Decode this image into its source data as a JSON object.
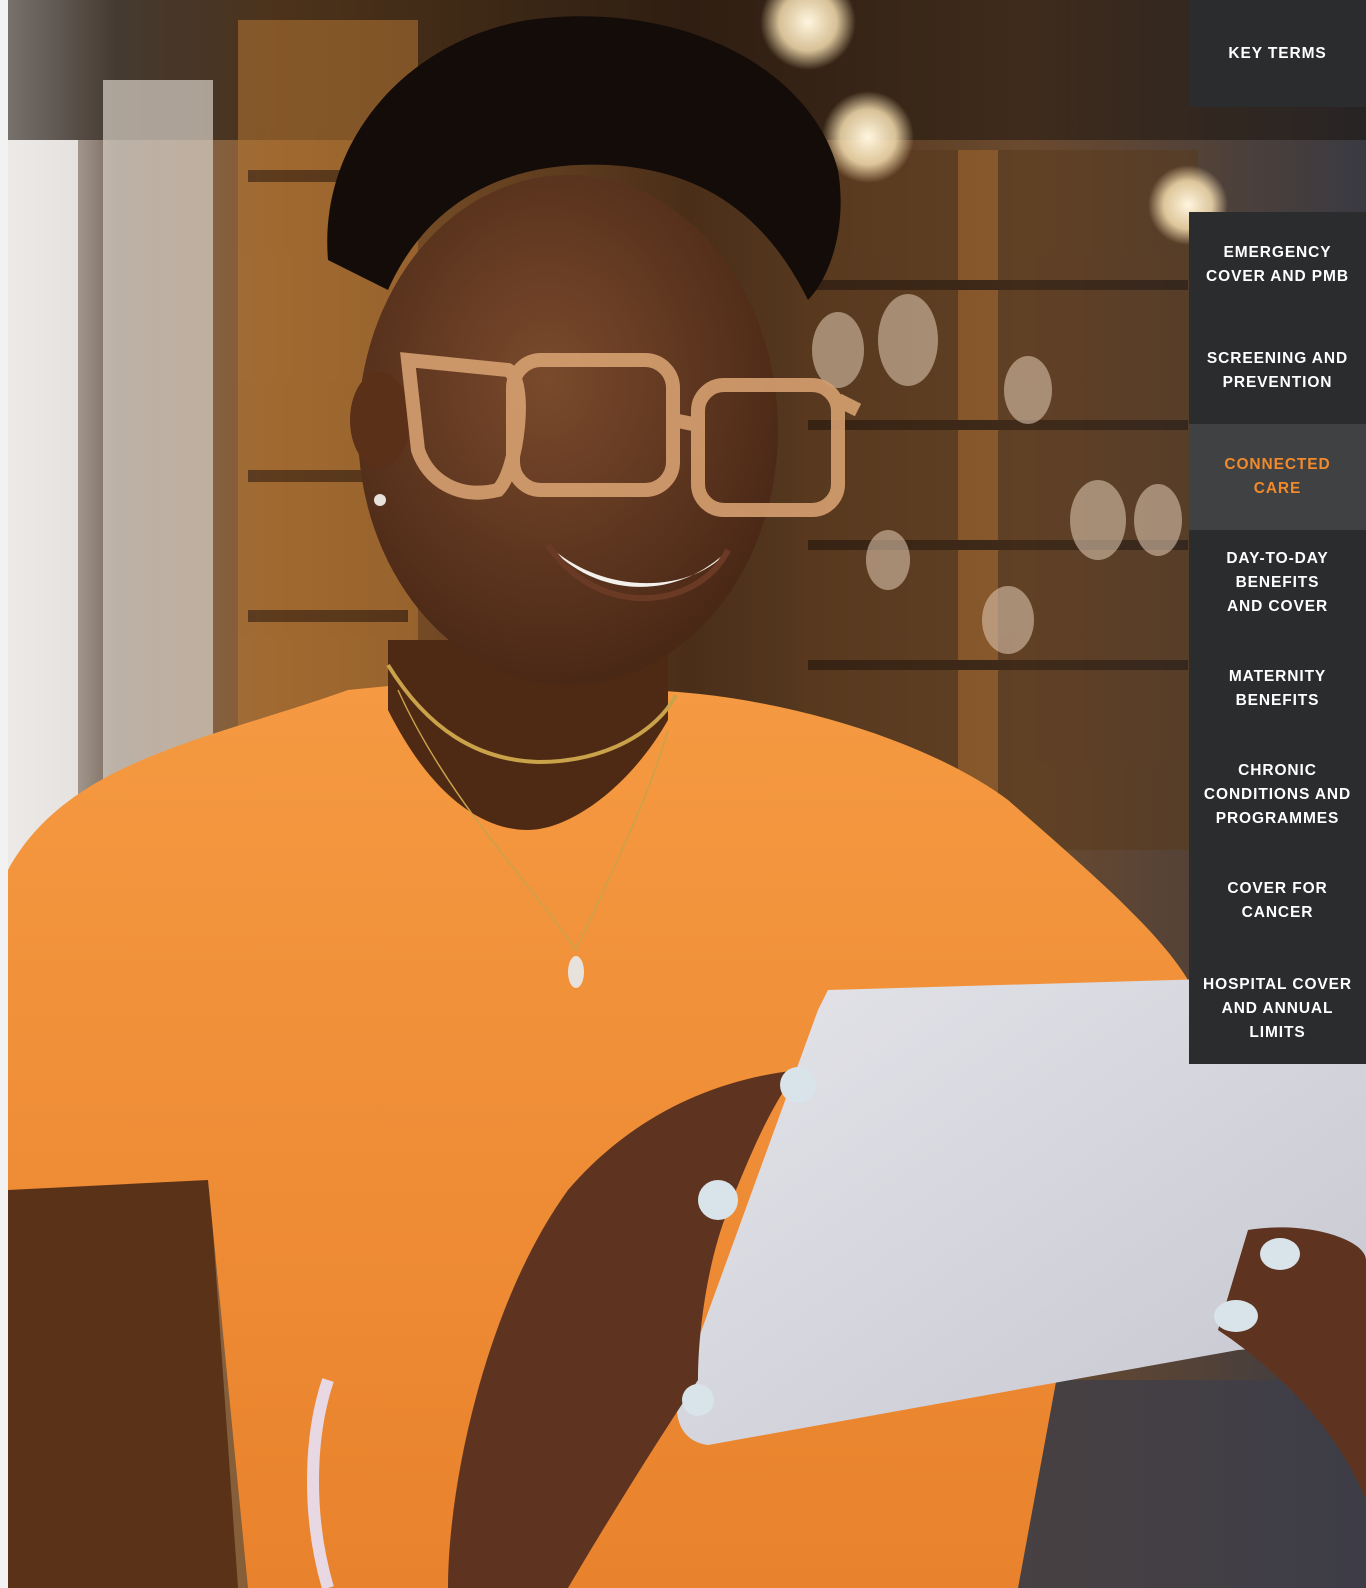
{
  "side_nav": {
    "key_terms_label": "KEY TERMS",
    "items": [
      {
        "label": "EMERGENCY\nCOVER AND PMB",
        "active": false
      },
      {
        "label": "SCREENING AND\nPREVENTION",
        "active": false
      },
      {
        "label": "CONNECTED\nCARE",
        "active": true
      },
      {
        "label": "DAY-TO-DAY\nBENEFITS\nAND COVER",
        "active": false
      },
      {
        "label": "MATERNITY\nBENEFITS",
        "active": false
      },
      {
        "label": "CHRONIC\nCONDITIONS AND\nPROGRAMMES",
        "active": false
      },
      {
        "label": "COVER FOR\nCANCER",
        "active": false
      },
      {
        "label": "HOSPITAL COVER\nAND ANNUAL\nLIMITS",
        "active": false
      }
    ]
  },
  "colors": {
    "nav_background": "#2b2c2e",
    "nav_active_background": "#404143",
    "nav_text": "#ffffff",
    "nav_active_text": "#f08a2a"
  }
}
